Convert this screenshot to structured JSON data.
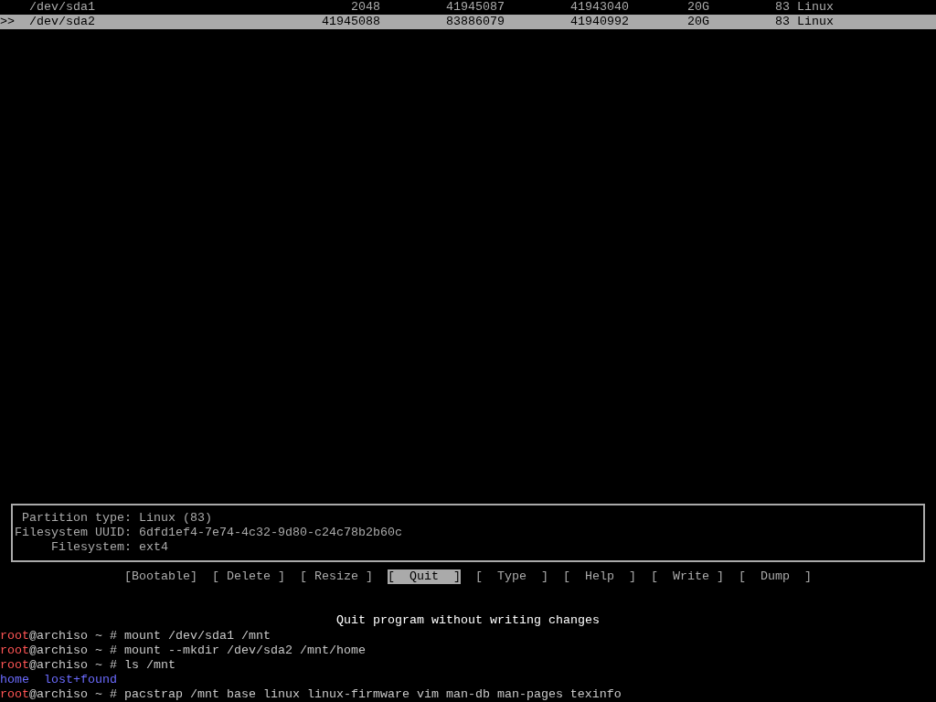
{
  "partition_table": {
    "cursor": ">>",
    "rows": [
      {
        "selected": false,
        "cells": [
          "/dev/sda1",
          "2048",
          "41945087",
          "41943040",
          "20G",
          "83 Linux"
        ]
      },
      {
        "selected": true,
        "cells": [
          "/dev/sda2",
          "41945088",
          "83886079",
          "41940992",
          "20G",
          "83 Linux"
        ]
      }
    ]
  },
  "partition_info": [
    {
      "label": "Partition type:",
      "value": "Linux (83)"
    },
    {
      "label": "Filesystem UUID:",
      "value": "6dfd1ef4-7e74-4c32-9d80-c24c78b2b60c"
    },
    {
      "label": "Filesystem:",
      "value": "ext4"
    }
  ],
  "menu": [
    {
      "label": "[Bootable]",
      "selected": false
    },
    {
      "label": "[ Delete ]",
      "selected": false
    },
    {
      "label": "[ Resize ]",
      "selected": false
    },
    {
      "label": "[  Quit  ]",
      "selected": true
    },
    {
      "label": "[  Type  ]",
      "selected": false
    },
    {
      "label": "[  Help  ]",
      "selected": false
    },
    {
      "label": "[  Write ]",
      "selected": false
    },
    {
      "label": "[  Dump  ]",
      "selected": false
    }
  ],
  "help_text": "Quit program without writing changes",
  "terminal": [
    {
      "kind": "command",
      "user": "root",
      "host": "@archiso ~ #",
      "command": "mount /dev/sda1 /mnt"
    },
    {
      "kind": "command",
      "user": "root",
      "host": "@archiso ~ #",
      "command": "mount --mkdir /dev/sda2 /mnt/home"
    },
    {
      "kind": "command",
      "user": "root",
      "host": "@archiso ~ #",
      "command": "ls /mnt"
    },
    {
      "kind": "listing",
      "entries": [
        "home",
        "lost+found"
      ]
    },
    {
      "kind": "command",
      "user": "root",
      "host": "@archiso ~ #",
      "command": "pacstrap /mnt base linux linux-firmware vim man-db man-pages texinfo"
    }
  ]
}
